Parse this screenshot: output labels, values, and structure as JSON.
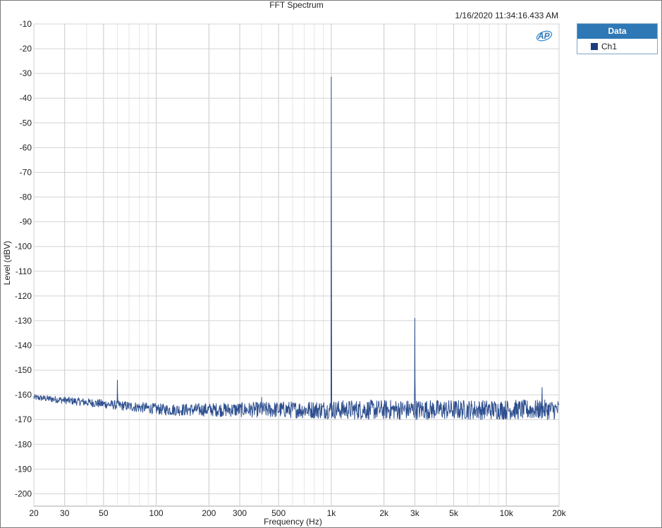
{
  "window": {
    "timestamp": "1/16/2020 11:34:16.433 AM"
  },
  "legend": {
    "title": "Data",
    "items": [
      {
        "label": "Ch1",
        "color": "#1c3d7f"
      }
    ]
  },
  "logo": {
    "text": "AP"
  },
  "chart_data": {
    "type": "line",
    "title": "FFT Spectrum",
    "xlabel": "Frequency (Hz)",
    "ylabel": "Level (dBV)",
    "x_scale": "log",
    "xlim": [
      20,
      20000
    ],
    "ylim": [
      -205,
      -10
    ],
    "grid": true,
    "legend_position": "right",
    "x_ticks": [
      {
        "value": 20,
        "label": "20"
      },
      {
        "value": 30,
        "label": "30"
      },
      {
        "value": 50,
        "label": "50"
      },
      {
        "value": 100,
        "label": "100"
      },
      {
        "value": 200,
        "label": "200"
      },
      {
        "value": 300,
        "label": "300"
      },
      {
        "value": 500,
        "label": "500"
      },
      {
        "value": 1000,
        "label": "1k"
      },
      {
        "value": 2000,
        "label": "2k"
      },
      {
        "value": 3000,
        "label": "3k"
      },
      {
        "value": 5000,
        "label": "5k"
      },
      {
        "value": 10000,
        "label": "10k"
      },
      {
        "value": 20000,
        "label": "20k"
      }
    ],
    "y_ticks": [
      -10,
      -20,
      -30,
      -40,
      -50,
      -60,
      -70,
      -80,
      -90,
      -100,
      -110,
      -120,
      -130,
      -140,
      -150,
      -160,
      -170,
      -180,
      -190,
      -200
    ],
    "series": [
      {
        "name": "Ch1",
        "color": "#2e4f8f",
        "noise_floor_start": -161,
        "noise_floor": -166,
        "peaks": [
          {
            "x": 60,
            "y": -154
          },
          {
            "x": 1000,
            "y": -31.5
          },
          {
            "x": 3000,
            "y": -129
          },
          {
            "x": 400,
            "y": -161
          },
          {
            "x": 16000,
            "y": -157
          }
        ]
      }
    ]
  }
}
